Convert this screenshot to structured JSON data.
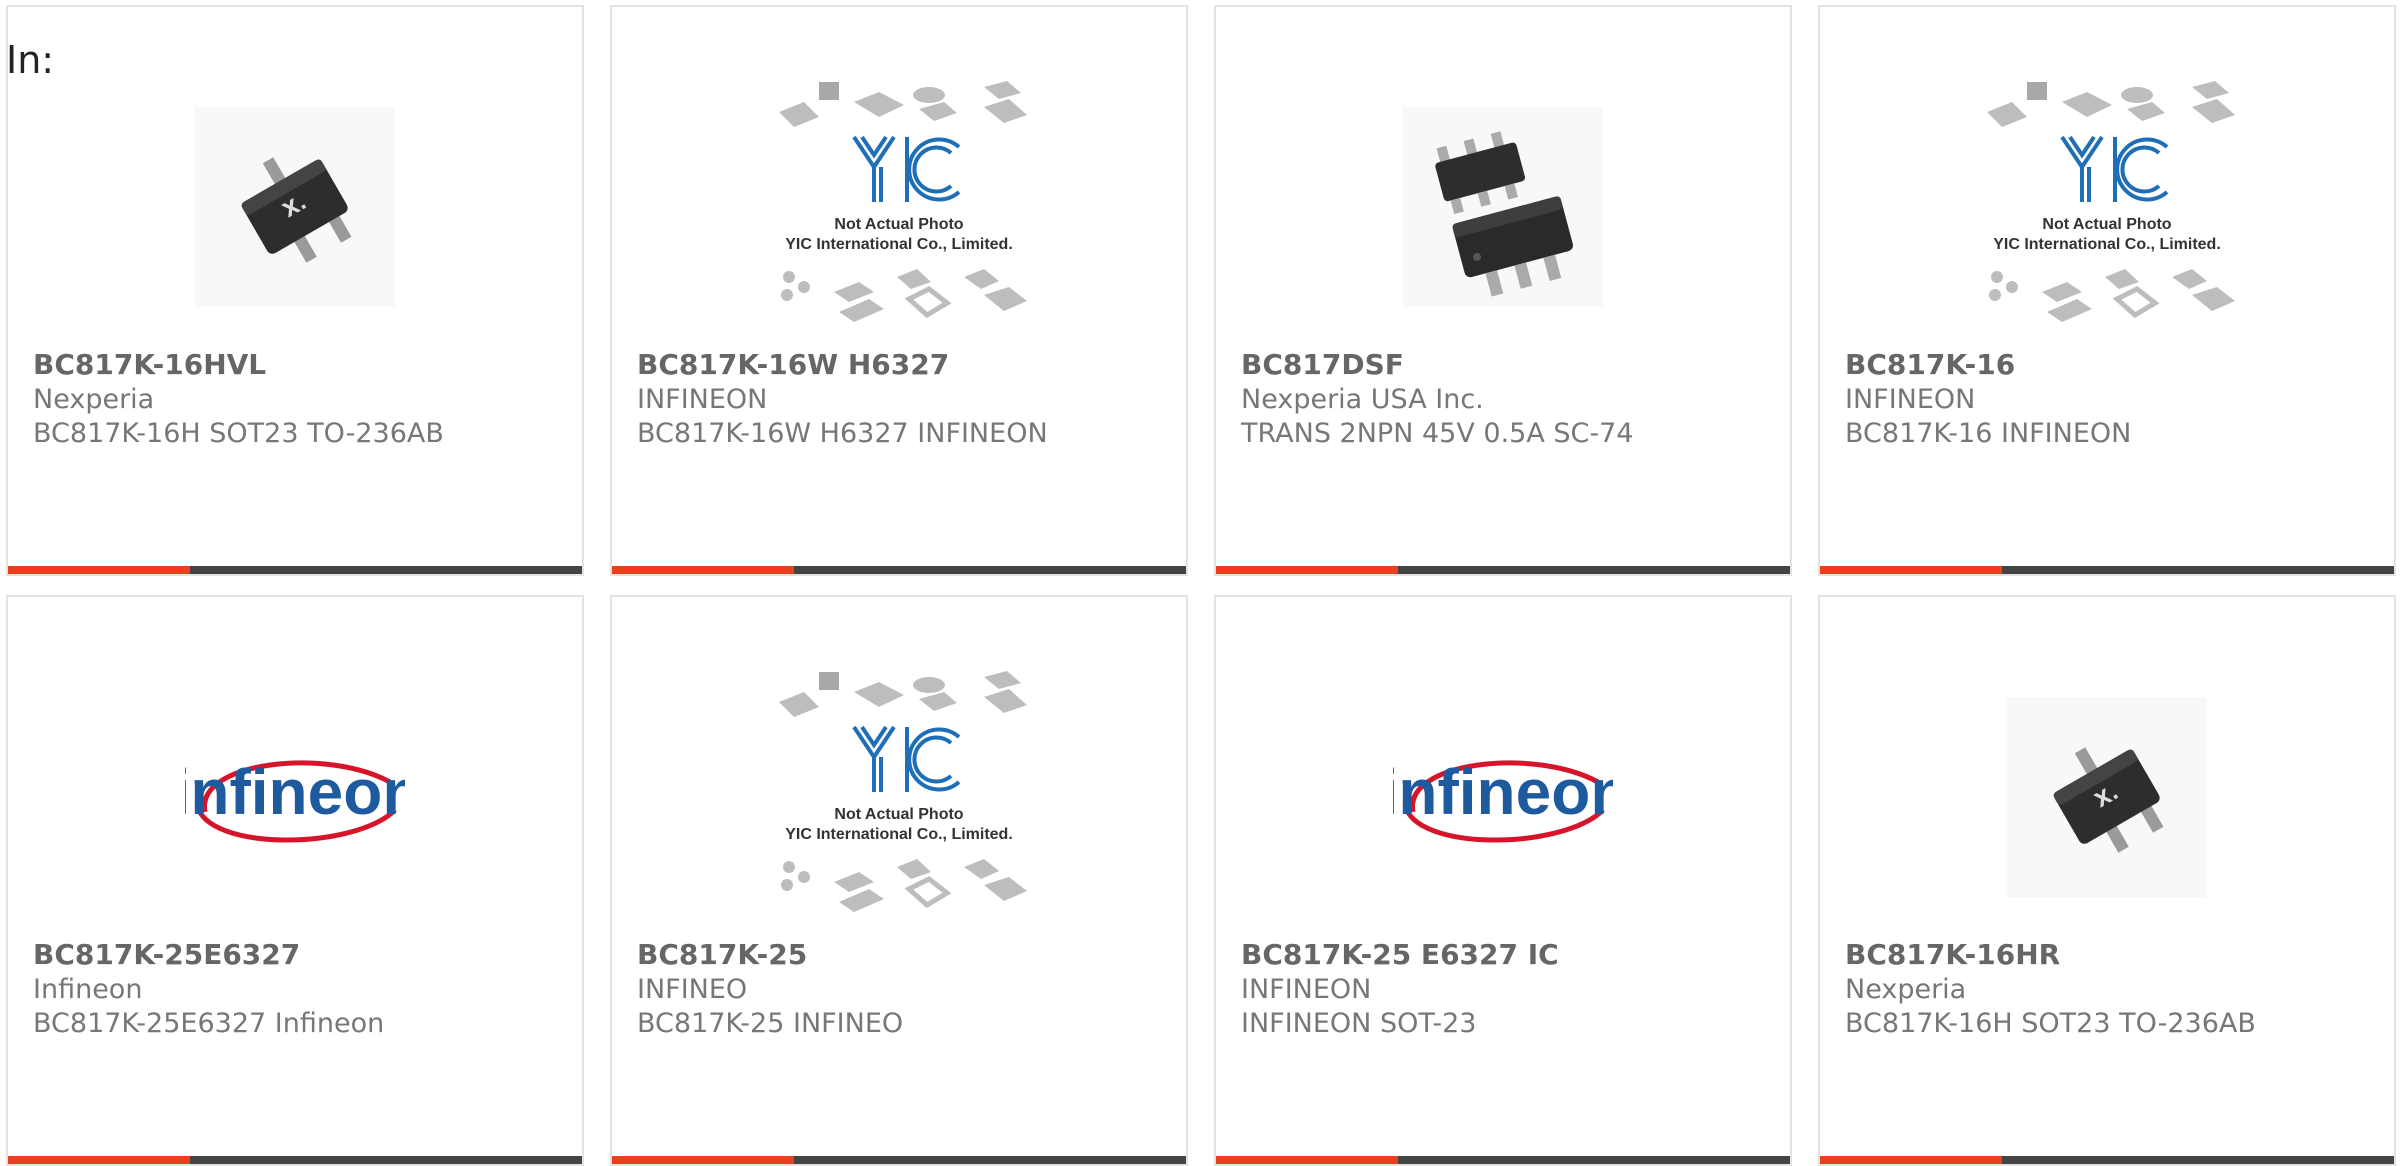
{
  "header": {
    "label": "In:"
  },
  "accent_color": "#e8401c",
  "bar_color": "#444444",
  "cards": [
    {
      "part_number": "BC817K-16HVL",
      "manufacturer": "Nexperia",
      "description": "BC817K-16H SOT23 TO-236AB",
      "image": "sot23-transistor-photo"
    },
    {
      "part_number": "BC817K-16W H6327",
      "manufacturer": "INFINEON",
      "description": "BC817K-16W H6327 INFINEON",
      "image": "yic-placeholder",
      "image_text": [
        "Not Actual Photo",
        "YIC International Co., Limited."
      ]
    },
    {
      "part_number": "BC817DSF",
      "manufacturer": "Nexperia USA Inc.",
      "description": "TRANS 2NPN 45V 0.5A SC-74",
      "image": "sc74-photo"
    },
    {
      "part_number": "BC817K-16",
      "manufacturer": "INFINEON",
      "description": "BC817K-16 INFINEON",
      "image": "yic-placeholder",
      "image_text": [
        "Not Actual Photo",
        "YIC International Co., Limited."
      ]
    },
    {
      "part_number": "BC817K-25E6327",
      "manufacturer": "Infineon",
      "description": "BC817K-25E6327 Infineon",
      "image": "infineon-logo",
      "logo_text": "infineon"
    },
    {
      "part_number": "BC817K-25",
      "manufacturer": "INFINEO",
      "description": "BC817K-25 INFINEO",
      "image": "yic-placeholder",
      "image_text": [
        "Not Actual Photo",
        "YIC International Co., Limited."
      ]
    },
    {
      "part_number": "BC817K-25 E6327 IC",
      "manufacturer": "INFINEON",
      "description": "INFINEON SOT-23",
      "image": "infineon-logo",
      "logo_text": "infineon"
    },
    {
      "part_number": "BC817K-16HR",
      "manufacturer": "Nexperia",
      "description": "BC817K-16H SOT23 TO-236AB",
      "image": "sot23-transistor-photo"
    }
  ]
}
